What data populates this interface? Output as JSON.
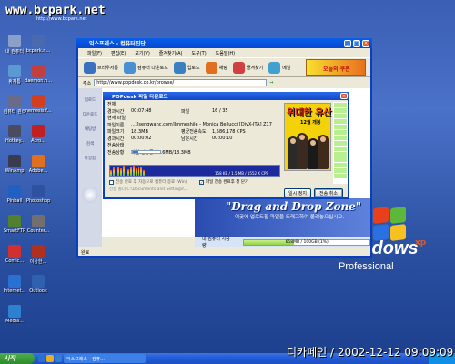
{
  "watermark": {
    "title": "www.bcpark.net",
    "subtitle": "http://www.bcpark.net"
  },
  "signature": "디카페인 / 2002-12-12 09:09:09",
  "desktop_icons": [
    {
      "label": "내 컴퓨터",
      "icon": "my-computer-icon",
      "color": "#8aa0c8"
    },
    {
      "label": "bcpark.n...",
      "icon": "shortcut-icon",
      "color": "#4a6ab0"
    },
    {
      "label": "휴지통",
      "icon": "recycle-bin-icon",
      "color": "#5a9ad0"
    },
    {
      "label": "daemon.n...",
      "icon": "daemon-icon",
      "color": "#c04040"
    },
    {
      "label": "컴퓨터 관리",
      "icon": "computer-manage-icon",
      "color": "#6a6a8a"
    },
    {
      "label": "nemesis.f...",
      "icon": "nemesis-icon",
      "color": "#d04020"
    },
    {
      "label": "Hotkey..",
      "icon": "hotkey-icon",
      "color": "#4a4a60"
    },
    {
      "label": "Acro...",
      "icon": "acrobat-icon",
      "color": "#c02020"
    },
    {
      "label": "WinAmp",
      "icon": "winamp-icon",
      "color": "#3a3a50"
    },
    {
      "label": "Adobe...",
      "icon": "adobe-icon",
      "color": "#e07020"
    },
    {
      "label": "Pinball",
      "icon": "pinball-icon",
      "color": "#2060c0"
    },
    {
      "label": "Photoshop",
      "icon": "photoshop-icon",
      "color": "#3050a0"
    },
    {
      "label": "SmartFTP",
      "icon": "smartftp-icon",
      "color": "#508030"
    },
    {
      "label": "Counter...",
      "icon": "counter-icon",
      "color": "#707070"
    },
    {
      "label": "Comic...",
      "icon": "comic-icon",
      "color": "#d03030"
    },
    {
      "label": "이상한...",
      "icon": "game-icon",
      "color": "#b03020"
    },
    {
      "label": "Internet...",
      "icon": "internet-icon",
      "color": "#2a70d0"
    },
    {
      "label": "Outlook",
      "icon": "outlook-icon",
      "color": "#3060b0"
    },
    {
      "label": "Media...",
      "icon": "media-icon",
      "color": "#3080d0"
    }
  ],
  "window": {
    "title": "익스프레스 - 컴퓨터진단",
    "menu": [
      "파일(F)",
      "편집(E)",
      "보기(V)",
      "즐겨찾기(A)",
      "도구(T)",
      "도움말(H)"
    ],
    "toolbar": [
      {
        "label": "브라우저통",
        "icon": "browser-icon",
        "color": "#3a70c0"
      },
      {
        "label": "컴퓨터 다운로드",
        "icon": "download-icon",
        "color": "#4a90d0"
      },
      {
        "label": "업로드",
        "icon": "upload-icon",
        "color": "#3a80c0"
      },
      {
        "label": "채팅",
        "icon": "chat-icon",
        "color": "#e07020"
      },
      {
        "label": "즐겨찾기",
        "icon": "favorites-icon",
        "color": "#d04040"
      },
      {
        "label": "메일",
        "icon": "mail-icon",
        "color": "#40a0d0"
      }
    ],
    "ad_text": "오늘의 쿠폰",
    "address_label": "주소",
    "address_value": "http://www.popdesk.co.kr/browse/",
    "address_go": "→",
    "sidebar": [
      "업로드",
      "다운로드",
      "채팅방",
      "검색",
      "파일함"
    ],
    "status_text": "완료",
    "drag_drop_title": "\"Drag and Drop Zone\"",
    "drag_drop_sub": "이곳에 업로드할 파일을 드래그하여 올려놓으십시오.",
    "capacity_label": "내 컴퓨터 사용량",
    "capacity_text": "658MB / 100GB (1%)",
    "capacity_percent": 1
  },
  "dialog": {
    "title": "POPdesk 파일 다운로드",
    "rows": [
      {
        "label": "전체",
        "value": ""
      },
      {
        "label": "경과시간",
        "value": "00:07:48",
        "label2": "파일",
        "value2": "16 / 35"
      },
      {
        "label": "현재 파일",
        "value": ""
      },
      {
        "label": "파일이름",
        "value": "...\\[sengwanc.com]Immeshile - Monica Bellucci [DivX-ITA] Z17"
      },
      {
        "label": "파일크기",
        "value": "18.3MB",
        "label2": "평균전송속도",
        "value2": "1,586,178 CPS"
      },
      {
        "label": "경과시간",
        "value": "00:00:02",
        "label2": "남은시간",
        "value2": "00:00:10"
      },
      {
        "label": "전송상태",
        "value": ""
      },
      {
        "label": "전송상황",
        "value": "파일 전송중 : 3.6MB/18.3MB"
      }
    ],
    "file_progress": 20,
    "bar_text": "158 KB / 1.5 MB / 1552 K CPS",
    "check1": "전송 완료 후 자동으로 컴퓨터 종료 (Win)",
    "check2": "파일 전송 완료후 창 닫기",
    "detail": "전송 폴더 C:\\Documents and Settings\\...",
    "poster_title": "위대한 유산",
    "poster_sub": "12월 개봉",
    "buttons": {
      "pause": "일시 정지",
      "cancel": "전송 취소"
    }
  },
  "taskbar": {
    "start": "시작",
    "task": "익스프레스 - 컴퓨...",
    "quicklaunch": [
      "ie-icon",
      "outlook-icon",
      "media-icon"
    ]
  }
}
